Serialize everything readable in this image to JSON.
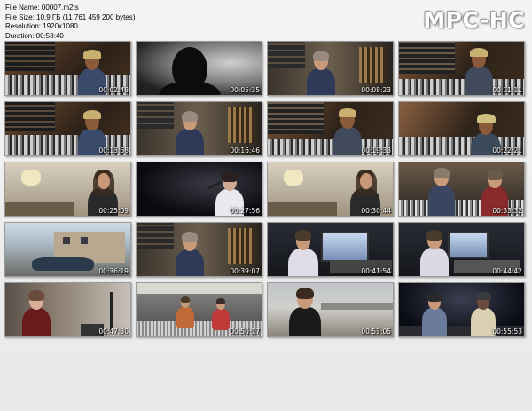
{
  "info": {
    "file_name": "File Name: 00007.m2ts",
    "file_size": "File Size: 10,9 ГБ (11 761 459 200 bytes)",
    "resolution": "Resolution: 1920x1080",
    "duration": "Duration: 00:58:40"
  },
  "logo": "MPC-HC",
  "thumbnails": [
    {
      "time": "00:02:48",
      "scene": "studio-cap"
    },
    {
      "time": "00:05:35",
      "scene": "silhouette"
    },
    {
      "time": "00:08:23",
      "scene": "bald-guitars"
    },
    {
      "time": "00:11:11",
      "scene": "studio-cap2"
    },
    {
      "time": "00:13:58",
      "scene": "studio-cap"
    },
    {
      "time": "00:16:46",
      "scene": "bald-guitars"
    },
    {
      "time": "00:19:33",
      "scene": "studio-cap2"
    },
    {
      "time": "00:22:21",
      "scene": "studio-cap3"
    },
    {
      "time": "00:25:09",
      "scene": "longhair"
    },
    {
      "time": "00:27:56",
      "scene": "stage-singer"
    },
    {
      "time": "00:30:44",
      "scene": "longhair"
    },
    {
      "time": "00:33:32",
      "scene": "console-two"
    },
    {
      "time": "00:36:19",
      "scene": "street-car"
    },
    {
      "time": "00:39:07",
      "scene": "bald-guitars"
    },
    {
      "time": "00:41:54",
      "scene": "monitors-man"
    },
    {
      "time": "00:44:42",
      "scene": "monitors-man2"
    },
    {
      "time": "00:47:30",
      "scene": "woman"
    },
    {
      "time": "00:50:17",
      "scene": "studio-wide"
    },
    {
      "time": "00:53:05",
      "scene": "river-man"
    },
    {
      "time": "00:55:53",
      "scene": "stage-two"
    }
  ]
}
